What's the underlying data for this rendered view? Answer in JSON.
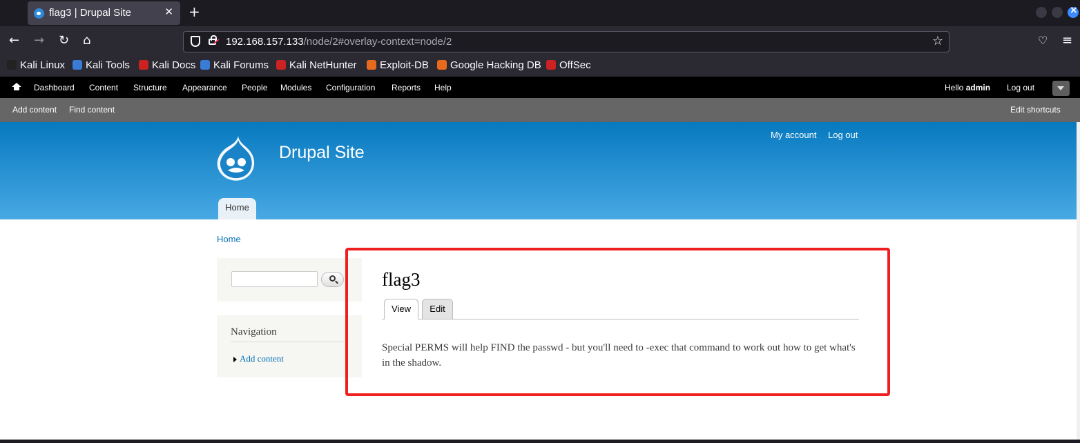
{
  "browser": {
    "tab_title": "flag3 | Drupal Site",
    "tab_close": "✕",
    "new_tab": "+",
    "url_host": "192.168.157.133",
    "url_path": "/node/2#overlay-context=node/2",
    "bookmarks": [
      {
        "label": "Kali Linux",
        "color": "#222222"
      },
      {
        "label": "Kali Tools",
        "color": "#3a7bd5"
      },
      {
        "label": "Kali Docs",
        "color": "#cc2222"
      },
      {
        "label": "Kali Forums",
        "color": "#3a7bd5"
      },
      {
        "label": "Kali NetHunter",
        "color": "#cc2222"
      },
      {
        "label": "Exploit-DB",
        "color": "#e86a1c"
      },
      {
        "label": "Google Hacking DB",
        "color": "#e86a1c"
      },
      {
        "label": "OffSec",
        "color": "#cc2222"
      }
    ]
  },
  "admin_toolbar": {
    "items": [
      "Dashboard",
      "Content",
      "Structure",
      "Appearance",
      "People",
      "Modules",
      "Configuration",
      "Reports",
      "Help"
    ],
    "hello_prefix": "Hello ",
    "username": "admin",
    "logout": "Log out"
  },
  "shortcuts": {
    "add_content": "Add content",
    "find_content": "Find content",
    "edit_shortcuts": "Edit shortcuts"
  },
  "site": {
    "name": "Drupal Site",
    "secondary_menu": [
      "My account",
      "Log out"
    ],
    "main_tab": "Home",
    "header_colors": [
      "#0779bf",
      "#48a9e4"
    ]
  },
  "breadcrumb": "Home",
  "sidebar": {
    "search_value": "",
    "navigation_title": "Navigation",
    "navigation_items": [
      "Add content"
    ]
  },
  "node": {
    "title": "flag3",
    "tabs": [
      "View",
      "Edit"
    ],
    "body": "Special PERMS will help FIND the passwd - but you'll need to -exec that command to work out how to get what's in the shadow."
  },
  "highlight_color": "#f01f1f"
}
